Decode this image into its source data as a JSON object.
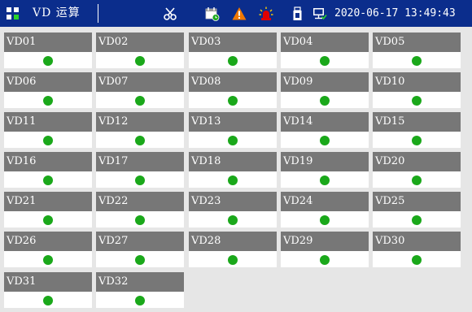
{
  "header": {
    "title": "VD 运算",
    "datetime": "2020-06-17 13:49:43",
    "icons": [
      "menu-grid-icon",
      "scissors-icon",
      "calendar-clock-icon",
      "warning-icon",
      "alarm-light-icon",
      "usb-drive-icon",
      "network-monitor-icon"
    ],
    "colors": {
      "bar": "#0b2d8c",
      "warning": "#f07800",
      "alarm": "#e00000",
      "ok": "#1aa81a"
    }
  },
  "tiles": [
    {
      "label": "VD01",
      "status": "on"
    },
    {
      "label": "VD02",
      "status": "on"
    },
    {
      "label": "VD03",
      "status": "on"
    },
    {
      "label": "VD04",
      "status": "on"
    },
    {
      "label": "VD05",
      "status": "on"
    },
    {
      "label": "VD06",
      "status": "on"
    },
    {
      "label": "VD07",
      "status": "on"
    },
    {
      "label": "VD08",
      "status": "on"
    },
    {
      "label": "VD09",
      "status": "on"
    },
    {
      "label": "VD10",
      "status": "on"
    },
    {
      "label": "VD11",
      "status": "on"
    },
    {
      "label": "VD12",
      "status": "on"
    },
    {
      "label": "VD13",
      "status": "on"
    },
    {
      "label": "VD14",
      "status": "on"
    },
    {
      "label": "VD15",
      "status": "on"
    },
    {
      "label": "VD16",
      "status": "on"
    },
    {
      "label": "VD17",
      "status": "on"
    },
    {
      "label": "VD18",
      "status": "on"
    },
    {
      "label": "VD19",
      "status": "on"
    },
    {
      "label": "VD20",
      "status": "on"
    },
    {
      "label": "VD21",
      "status": "on"
    },
    {
      "label": "VD22",
      "status": "on"
    },
    {
      "label": "VD23",
      "status": "on"
    },
    {
      "label": "VD24",
      "status": "on"
    },
    {
      "label": "VD25",
      "status": "on"
    },
    {
      "label": "VD26",
      "status": "on"
    },
    {
      "label": "VD27",
      "status": "on"
    },
    {
      "label": "VD28",
      "status": "on"
    },
    {
      "label": "VD29",
      "status": "on"
    },
    {
      "label": "VD30",
      "status": "on"
    },
    {
      "label": "VD31",
      "status": "on"
    },
    {
      "label": "VD32",
      "status": "on"
    }
  ]
}
